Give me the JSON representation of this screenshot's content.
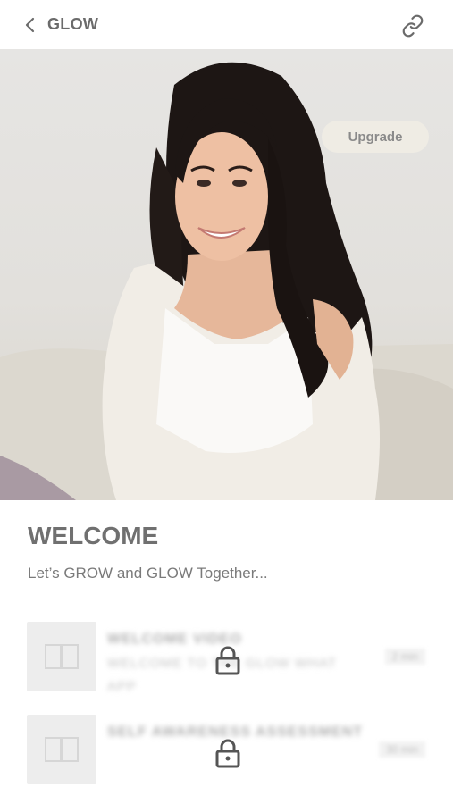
{
  "header": {
    "title": "GLOW",
    "back_icon": "chevron-left-icon",
    "link_icon": "link-icon"
  },
  "hero": {
    "upgrade_label": "Upgrade"
  },
  "content": {
    "title": "WELCOME",
    "subtitle": "Let’s GROW and GLOW Together..."
  },
  "lessons": [
    {
      "title": "WELCOME VIDEO",
      "description": "WELCOME TO THE GLOW WHAT APP",
      "duration": "2 min",
      "locked": true
    },
    {
      "title": "SELF AWARENESS ASSESSMENT",
      "description": "",
      "duration": "30 min",
      "locked": true
    }
  ],
  "colors": {
    "header_text": "#6b6b6b",
    "upgrade_bg": "#efece4",
    "thumb_bg": "#ededed",
    "lock_color": "#555555"
  }
}
